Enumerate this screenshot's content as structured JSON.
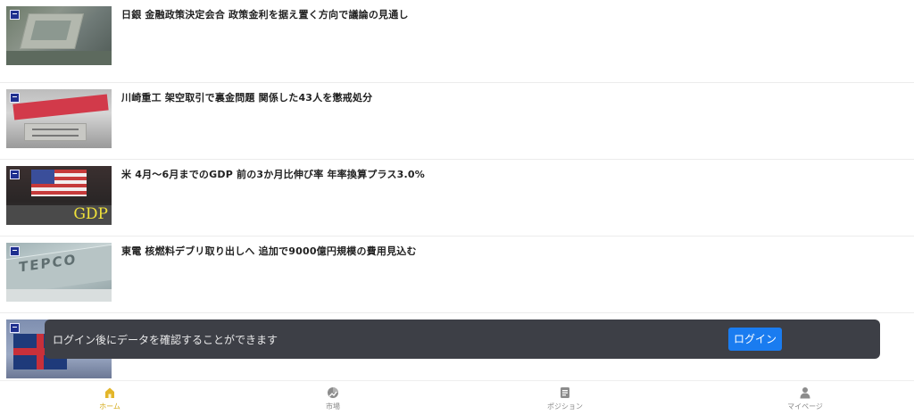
{
  "news": [
    {
      "title": "日銀 金融政策決定会合 政策金利を据え置く方向で議論の見通し",
      "thumb": "bank-of-japan-building",
      "source_badge": "NHK"
    },
    {
      "title": "川崎重工 架空取引で裏金問題 関係した43人を懲戒処分",
      "thumb": "kawasaki-sign",
      "source_badge": "NHK"
    },
    {
      "title": "米 4月～6月までのGDP 前の3か月比伸び率 年率換算プラス3.0%",
      "thumb": "us-flag-gdp",
      "source_badge": "NHK",
      "thumb_caption": "GDP"
    },
    {
      "title": "東電 核燃料デブリ取り出しへ 追加で9000億円規模の費用見込む",
      "thumb": "tepco-building",
      "source_badge": "NHK"
    },
    {
      "title": "",
      "thumb": "uk-flag",
      "source_badge": "NHK"
    }
  ],
  "toast": {
    "message": "ログイン後にデータを確認することができます",
    "login_label": "ログイン"
  },
  "tabbar": [
    {
      "label": "ホーム",
      "icon": "home-icon",
      "active": true
    },
    {
      "label": "市場",
      "icon": "market-icon",
      "active": false
    },
    {
      "label": "ポジション",
      "icon": "position-icon",
      "active": false
    },
    {
      "label": "マイページ",
      "icon": "user-icon",
      "active": false
    }
  ],
  "colors": {
    "active_tab": "#d4a917",
    "inactive_tab": "#8a8a8a",
    "toast_bg": "#3d3f46",
    "login_button": "#1a7cf0"
  }
}
